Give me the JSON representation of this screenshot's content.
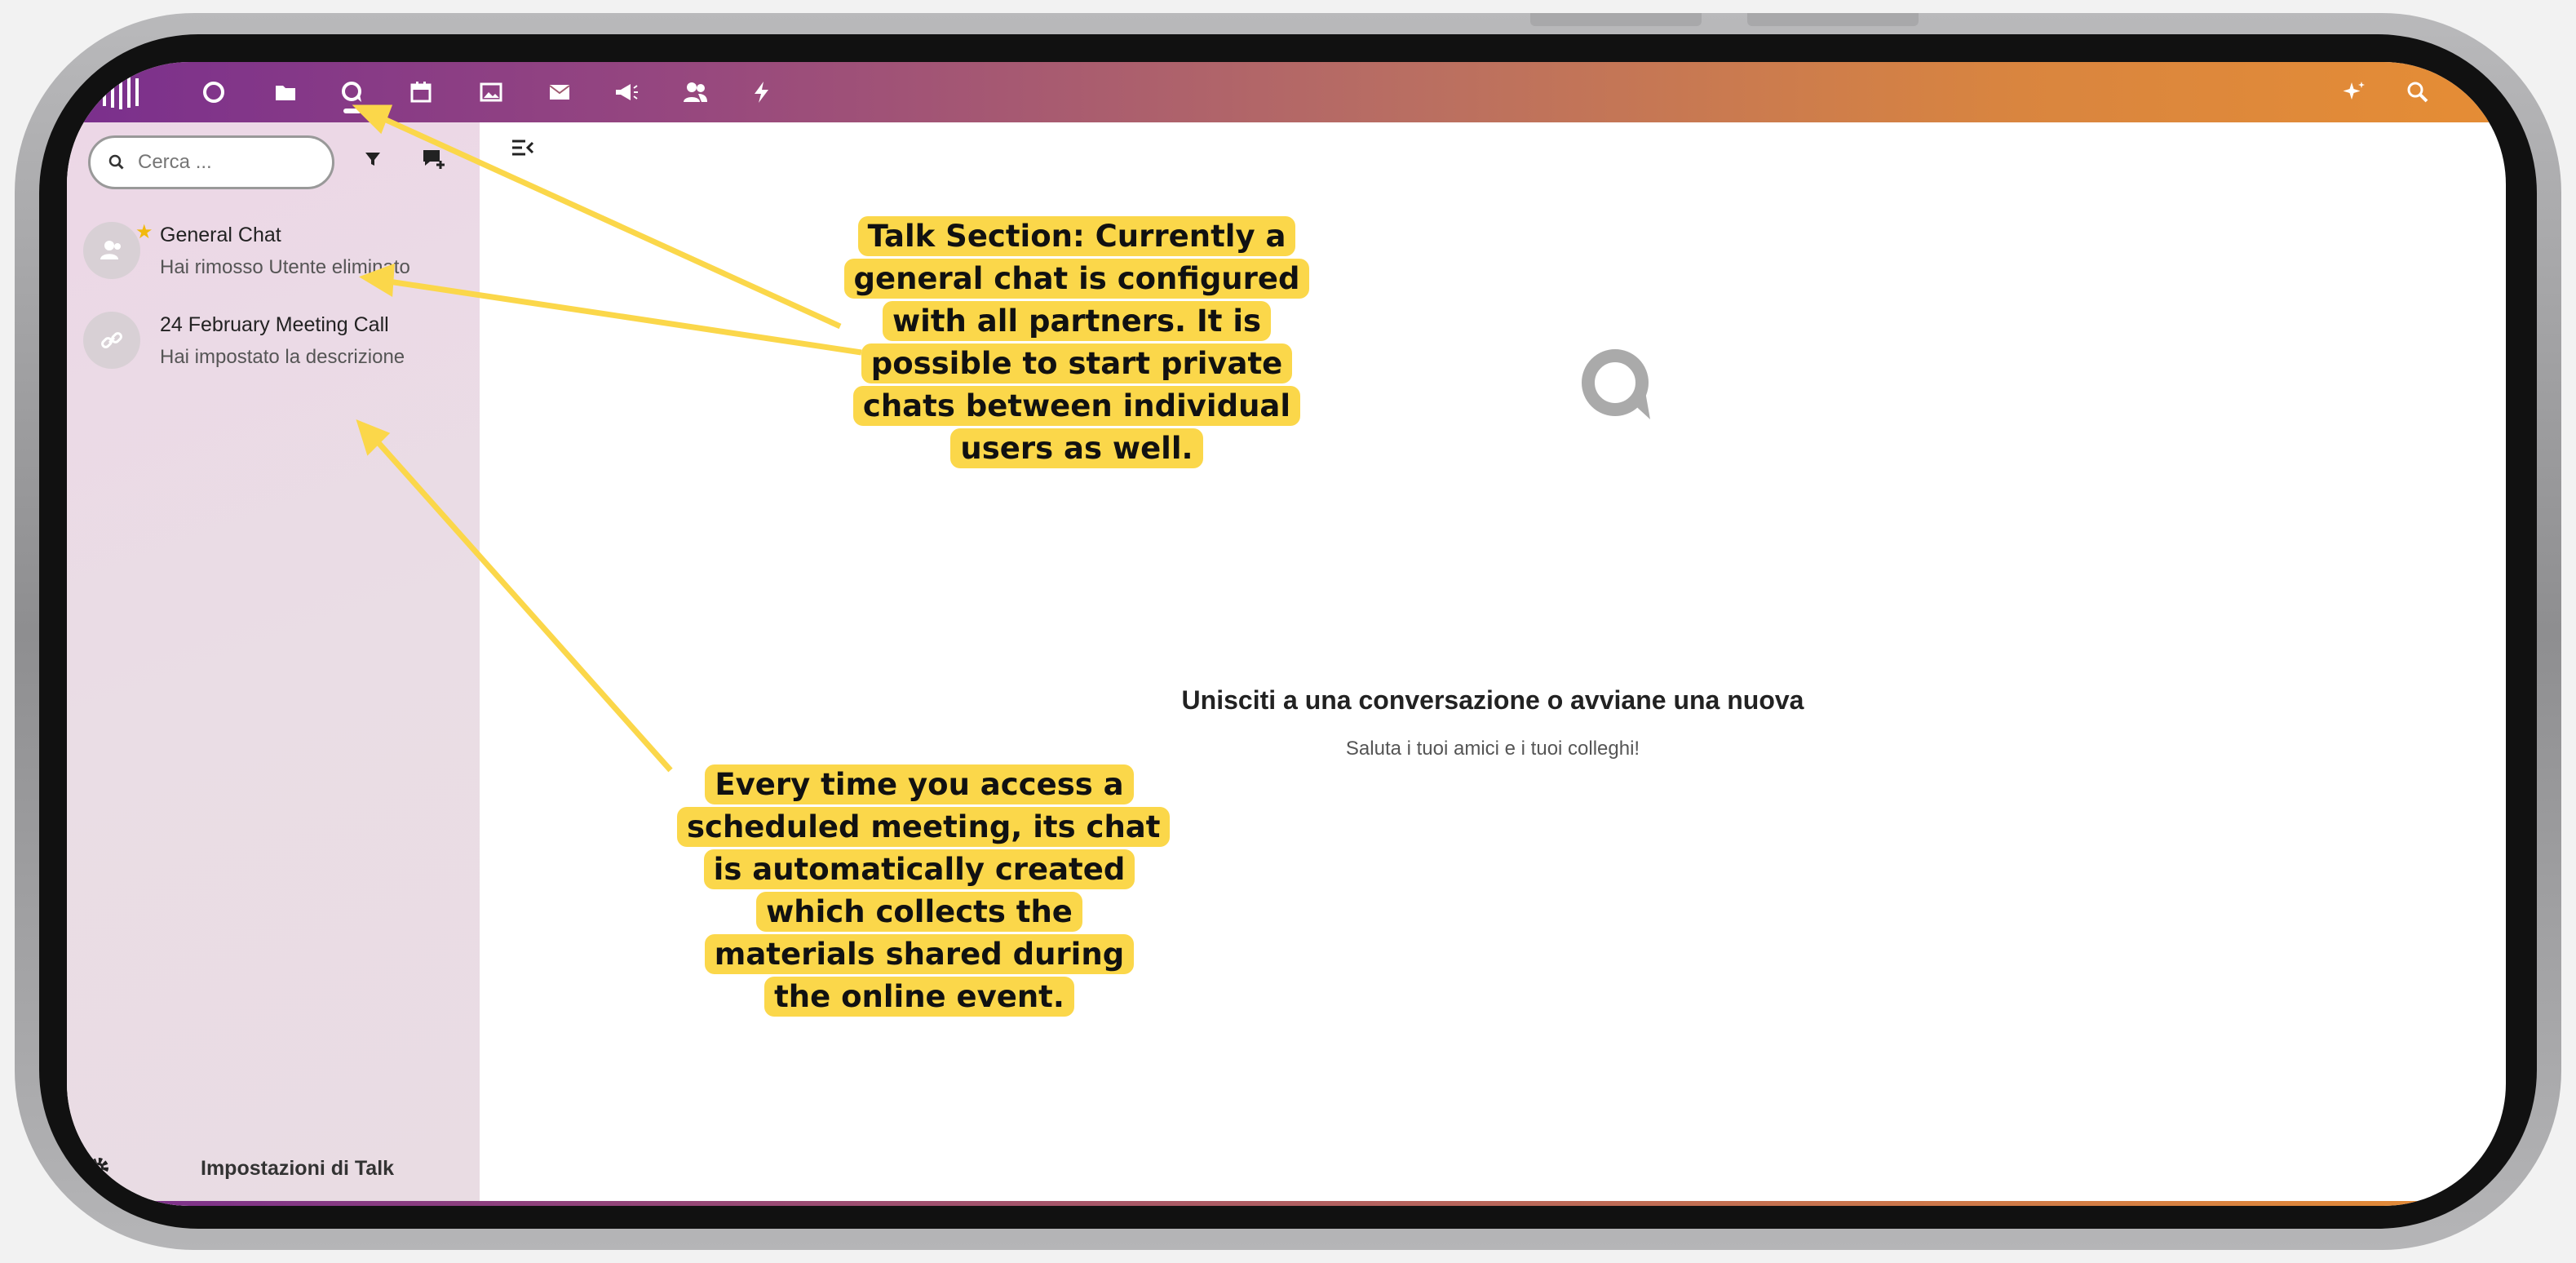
{
  "nav": {
    "icons": [
      "dashboard-icon",
      "files-icon",
      "talk-icon",
      "calendar-icon",
      "photos-icon",
      "mail-icon",
      "announcements-icon",
      "contacts-icon",
      "activity-icon"
    ],
    "right_icons": [
      "assistant-icon",
      "search-icon"
    ]
  },
  "sidebar": {
    "search_placeholder": "Cerca ...",
    "conversations": [
      {
        "title": "General Chat",
        "subtitle": "Hai rimosso Utente eliminato",
        "favorite": true
      },
      {
        "title": "24 February Meeting Call",
        "subtitle": "Hai impostato la descrizione",
        "favorite": false
      }
    ],
    "settings_label": "Impostazioni di Talk"
  },
  "main": {
    "empty_title": "Unisciti a una conversazione o avviane una nuova",
    "empty_subtitle": "Saluta i tuoi amici e i tuoi colleghi!"
  },
  "annotations": {
    "talk_section": "Talk Section: Currently a general chat is configured with all partners. It is possible to start private chats between individual users as well.",
    "meeting_chat": "Every time you access a scheduled meeting, its chat is automatically created which collects the materials shared during the online event."
  },
  "colors": {
    "gradient_start": "#7a2f8d",
    "gradient_end": "#e58d35",
    "callout_bg": "#fbd74a",
    "favorite_star": "#f2b90d"
  }
}
